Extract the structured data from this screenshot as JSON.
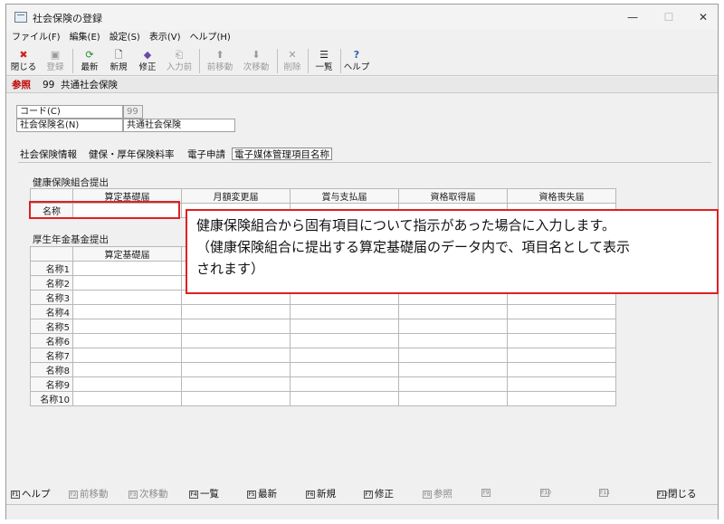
{
  "window": {
    "title": "社会保険の登録",
    "controls": {
      "minimize": "—",
      "maximize": "☐",
      "close": "✕"
    }
  },
  "menu": [
    "ファイル(F)",
    "編集(E)",
    "設定(S)",
    "表示(V)",
    "ヘルプ(H)"
  ],
  "toolbar": [
    {
      "label": "閉じる",
      "icon": "close-icon",
      "glyph": "✖",
      "enabled": true
    },
    {
      "label": "登録",
      "icon": "save-icon",
      "glyph": "▣",
      "enabled": false
    },
    {
      "label": "最新",
      "icon": "refresh-icon",
      "glyph": "⟳",
      "enabled": true
    },
    {
      "label": "新規",
      "icon": "new-document-icon",
      "glyph": "🗋",
      "enabled": true
    },
    {
      "label": "修正",
      "icon": "edit-icon",
      "glyph": "◆",
      "enabled": true
    },
    {
      "label": "入力前",
      "icon": "undo-input-icon",
      "glyph": "⎗",
      "enabled": false
    },
    {
      "label": "前移動",
      "icon": "arrow-up-icon",
      "glyph": "⬆",
      "enabled": false
    },
    {
      "label": "次移動",
      "icon": "arrow-down-icon",
      "glyph": "⬇",
      "enabled": false
    },
    {
      "label": "削除",
      "icon": "delete-icon",
      "glyph": "✕",
      "enabled": false
    },
    {
      "label": "一覧",
      "icon": "list-icon",
      "glyph": "☰",
      "enabled": true
    },
    {
      "label": "ヘルプ",
      "icon": "help-icon",
      "glyph": "?",
      "enabled": true
    }
  ],
  "mode": {
    "label": "参照",
    "code": "99",
    "name": "共通社会保険"
  },
  "fields": {
    "code_label": "コード(C)",
    "code_value": "99",
    "name_label": "社会保険名(N)",
    "name_value": "共通社会保険"
  },
  "tabs": [
    "社会保険情報",
    "健保・厚年保険料率",
    "電子申請",
    "電子媒体管理項目名称"
  ],
  "active_tab": "電子媒体管理項目名称",
  "health": {
    "title": "健康保険組合提出",
    "columns": [
      "算定基礎届",
      "月額変更届",
      "賞与支払届",
      "資格取得届",
      "資格喪失届"
    ],
    "row_label": "名称"
  },
  "pension": {
    "title": "厚生年金基金提出",
    "columns": [
      "算定基礎届"
    ],
    "rows": [
      "名称1",
      "名称2",
      "名称3",
      "名称4",
      "名称5",
      "名称6",
      "名称7",
      "名称8",
      "名称9",
      "名称10"
    ]
  },
  "callout": {
    "line1": "健康保険組合から固有項目について指示があった場合に入力します。",
    "line2": "（健康保険組合に提出する算定基礎届のデータ内で、項目名として表示",
    "line3": "されます）"
  },
  "fkeys": [
    {
      "key": "F1",
      "label": "ヘルプ",
      "enabled": true
    },
    {
      "key": "F2",
      "label": "前移動",
      "enabled": false
    },
    {
      "key": "F3",
      "label": "次移動",
      "enabled": false
    },
    {
      "key": "F4",
      "label": "一覧",
      "enabled": true
    },
    {
      "key": "F5",
      "label": "最新",
      "enabled": true
    },
    {
      "key": "F6",
      "label": "新規",
      "enabled": true
    },
    {
      "key": "F7",
      "label": "修正",
      "enabled": true
    },
    {
      "key": "F8",
      "label": "参照",
      "enabled": false
    },
    {
      "key": "F9",
      "label": "",
      "enabled": false
    },
    {
      "key": "F10",
      "label": "",
      "enabled": false
    },
    {
      "key": "F11",
      "label": "",
      "enabled": false
    },
    {
      "key": "F12",
      "label": "閉じる",
      "enabled": true
    }
  ],
  "colors": {
    "highlight": "#e02020",
    "mode_label": "#c00000"
  }
}
